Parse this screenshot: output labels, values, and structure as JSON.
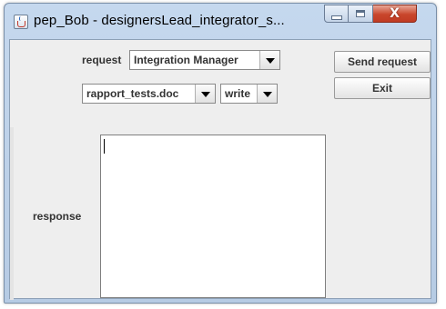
{
  "window": {
    "title": "pep_Bob - designersLead_integrator_s...",
    "close_symbol": "X"
  },
  "form": {
    "request_label": "request",
    "request_value": "Integration Manager",
    "document_value": "rapport_tests.doc",
    "action_value": "write",
    "response_label": "response",
    "response_value": ""
  },
  "buttons": {
    "send_label": "Send request",
    "exit_label": "Exit"
  },
  "icons": {
    "app": "java-cup-icon",
    "minimize": "minimize-icon",
    "maximize": "maximize-icon",
    "close": "close-icon",
    "dropdown": "chevron-down-icon"
  }
}
